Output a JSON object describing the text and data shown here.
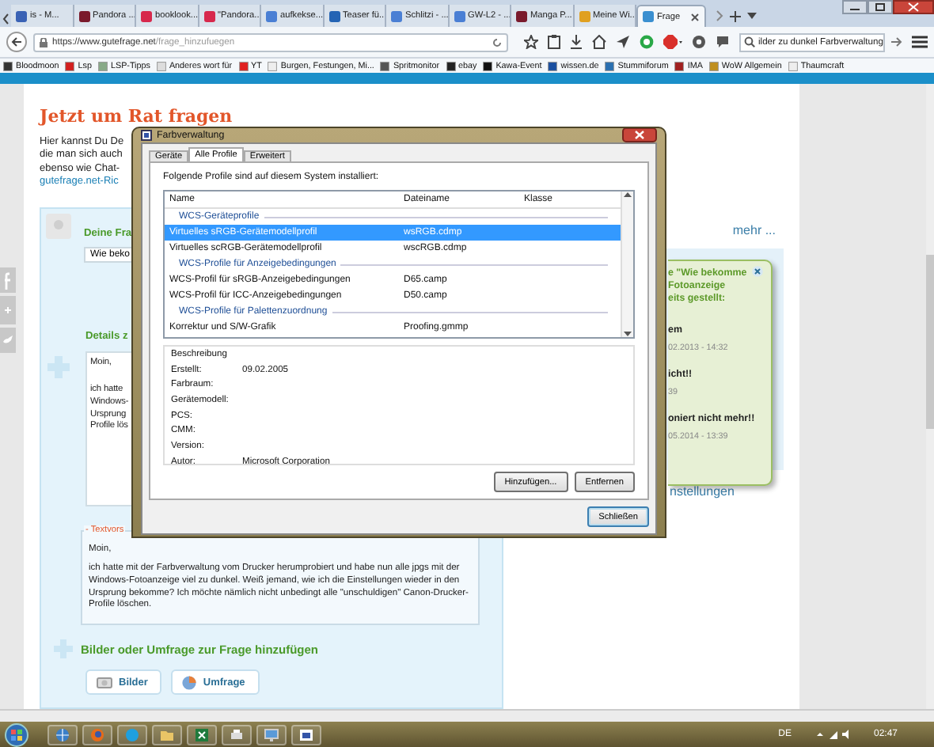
{
  "browser": {
    "tabs": [
      {
        "label": "is - M...",
        "selected": false
      },
      {
        "label": "Pandora ...",
        "selected": false
      },
      {
        "label": "booklook...",
        "selected": false
      },
      {
        "label": "\"Pandora...",
        "selected": false
      },
      {
        "label": "aufkekse...",
        "selected": false
      },
      {
        "label": "Teaser fü...",
        "selected": false
      },
      {
        "label": "Schlitzi - ...",
        "selected": false
      },
      {
        "label": "GW-L2 - ...",
        "selected": false
      },
      {
        "label": "Manga P...",
        "selected": false
      },
      {
        "label": "Meine Wi...",
        "selected": false
      },
      {
        "label": "Frage",
        "selected": true
      }
    ],
    "url": {
      "host": "https://www.gutefrage.net",
      "path": "/frage_hinzufuegen"
    },
    "search": {
      "value": "ilder zu dunkel Farbverwaltung"
    },
    "bookmarks": [
      "Bloodmoon",
      "Lsp",
      "LSP-Tipps",
      "Anderes wort für",
      "YT",
      "Burgen, Festungen, Mi...",
      "Spritmonitor",
      "ebay",
      "Kawa-Event",
      "wissen.de",
      "Stummiforum",
      "IMA",
      "WoW Allgemein",
      "Thaumcraft"
    ]
  },
  "page": {
    "heading": "Jetzt um Rat fragen",
    "intro": [
      "Hier kannst Du De",
      "die man sich auch",
      "ebenso wie Chat-"
    ],
    "intro_link": "gutefrage.net-Ric",
    "question": {
      "label": "Deine Fra",
      "value": "Wie beko"
    },
    "details": {
      "label": "Details z",
      "lines": [
        "Moin,",
        "ich hatte",
        "Windows-",
        "Ursprung",
        "Profile lös"
      ]
    },
    "template": {
      "label": "- Textvors",
      "greeting": "Moin,",
      "body": "ich hatte mit der Farbverwaltung vom Drucker herumprobiert und habe nun alle jpgs mit der Windows-Fotoanzeige viel zu dunkel. Weiß jemand, wie ich die Einstellungen wieder in den Ursprung bekomme? Ich möchte nämlich nicht unbedingt alle \"unschuldigen\" Canon-Drucker-Profile löschen."
    },
    "media": {
      "heading": "Bilder oder Umfrage zur Frage hinzufügen",
      "buttons": [
        {
          "kind": "images",
          "label": "Bilder"
        },
        {
          "kind": "poll",
          "label": "Umfrage"
        }
      ]
    },
    "more_link": "mehr ...",
    "popup": {
      "title": [
        "e \"Wie bekomme",
        "Fotoanzeige",
        "eits gestellt:"
      ],
      "items": [
        {
          "title": "em",
          "meta": "02.2013 - 14:32"
        },
        {
          "title": "icht!!",
          "meta": "39"
        },
        {
          "title": "oniert nicht mehr!!",
          "meta": "05.2014 - 13:39"
        }
      ]
    },
    "settings_link": "nstellungen"
  },
  "dialog": {
    "title": "Farbverwaltung",
    "tabs": [
      {
        "label": "Geräte",
        "selected": false
      },
      {
        "label": "Alle Profile",
        "selected": true
      },
      {
        "label": "Erweitert",
        "selected": false
      }
    ],
    "intro": "Folgende Profile sind auf diesem System installiert:",
    "columns": [
      "Name",
      "Dateiname",
      "Klasse"
    ],
    "rows": [
      {
        "kind": "group",
        "name": "WCS-Geräteprofile"
      },
      {
        "kind": "profile",
        "name": "Virtuelles sRGB-Gerätemodellprofil",
        "file": "wsRGB.cdmp",
        "selected": true
      },
      {
        "kind": "profile",
        "name": "Virtuelles scRGB-Gerätemodellprofil",
        "file": "wscRGB.cdmp",
        "selected": false
      },
      {
        "kind": "group",
        "name": "WCS-Profile für Anzeigebedingungen"
      },
      {
        "kind": "profile",
        "name": "WCS-Profil für sRGB-Anzeigebedingungen",
        "file": "D65.camp",
        "selected": false
      },
      {
        "kind": "profile",
        "name": "WCS-Profil für ICC-Anzeigebedingungen",
        "file": "D50.camp",
        "selected": false
      },
      {
        "kind": "group",
        "name": "WCS-Profile für Palettenzuordnung"
      },
      {
        "kind": "profile",
        "name": "Korrektur und S/W-Grafik",
        "file": "Proofing.gmmp",
        "selected": false
      }
    ],
    "description": {
      "label": "Beschreibung",
      "fields": [
        {
          "label": "Erstellt:",
          "value": "09.02.2005"
        },
        {
          "label": "Farbraum:"
        },
        {
          "label": "Gerätemodell:"
        },
        {
          "label": "PCS:"
        },
        {
          "label": "CMM:"
        },
        {
          "label": "Version:"
        },
        {
          "label": "Autor:",
          "value": "Microsoft Corporation"
        }
      ]
    },
    "buttons": [
      "Hinzufügen...",
      "Entfernen"
    ],
    "close_button": "Schließen"
  },
  "taskbar": {
    "language": "DE",
    "clock": "02:47"
  }
}
